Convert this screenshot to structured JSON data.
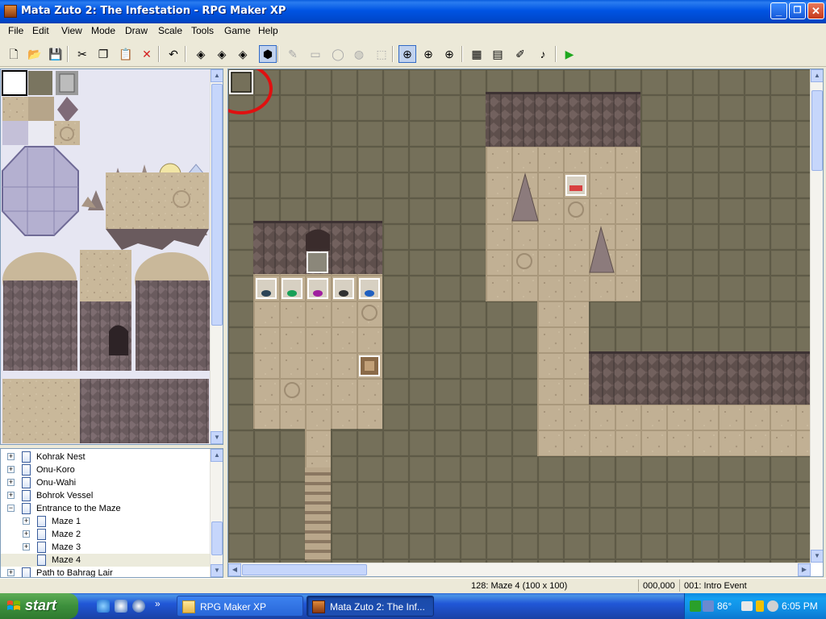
{
  "window": {
    "title": "Mata Zuto 2: The Infestation - RPG Maker XP",
    "minimize": "_",
    "maximize": "❐",
    "close": "✕"
  },
  "menu": [
    "File",
    "Edit",
    "View",
    "Mode",
    "Draw",
    "Scale",
    "Tools",
    "Game",
    "Help"
  ],
  "toolbar": {
    "buttons": [
      {
        "name": "new-project-button",
        "icon": "new-icon",
        "glyph": "🗋"
      },
      {
        "name": "open-project-button",
        "icon": "folder-open-icon",
        "glyph": "📂"
      },
      {
        "name": "save-project-button",
        "icon": "save-icon",
        "glyph": "💾"
      },
      {
        "name": "cut-button",
        "icon": "scissors-icon",
        "glyph": "✂"
      },
      {
        "name": "copy-button",
        "icon": "copy-icon",
        "glyph": "❐"
      },
      {
        "name": "paste-button",
        "icon": "paste-icon",
        "glyph": "📋"
      },
      {
        "name": "delete-button",
        "icon": "delete-icon",
        "glyph": "✕"
      },
      {
        "name": "undo-button",
        "icon": "undo-icon",
        "glyph": "↶"
      },
      {
        "name": "layer1-button",
        "icon": "layer1-icon",
        "glyph": "◈"
      },
      {
        "name": "layer2-button",
        "icon": "layer2-icon",
        "glyph": "◈"
      },
      {
        "name": "layer3-button",
        "icon": "layer3-icon",
        "glyph": "◈"
      },
      {
        "name": "event-layer-button",
        "icon": "event-layer-icon",
        "glyph": "⬢"
      },
      {
        "name": "pencil-button",
        "icon": "pencil-icon",
        "glyph": "✎"
      },
      {
        "name": "rectangle-button",
        "icon": "rectangle-icon",
        "glyph": "▭"
      },
      {
        "name": "ellipse-button",
        "icon": "ellipse-icon",
        "glyph": "◯"
      },
      {
        "name": "fill-button",
        "icon": "fill-icon",
        "glyph": "◍"
      },
      {
        "name": "select-button",
        "icon": "select-icon",
        "glyph": "⬚"
      },
      {
        "name": "zoom-1-1-button",
        "icon": "zoom-1-1-icon",
        "glyph": "⊕"
      },
      {
        "name": "zoom-1-2-button",
        "icon": "zoom-1-2-icon",
        "glyph": "⊕"
      },
      {
        "name": "zoom-1-4-button",
        "icon": "zoom-1-4-icon",
        "glyph": "⊕"
      },
      {
        "name": "database-button",
        "icon": "database-icon",
        "glyph": "▦"
      },
      {
        "name": "materialbase-button",
        "icon": "materialbase-icon",
        "glyph": "▤"
      },
      {
        "name": "script-editor-button",
        "icon": "script-icon",
        "glyph": "✐"
      },
      {
        "name": "sound-test-button",
        "icon": "music-note-icon",
        "glyph": "♪"
      },
      {
        "name": "playtest-button",
        "icon": "play-icon",
        "glyph": "▶"
      }
    ],
    "colors": {
      "playtest": "#1ea81e",
      "delete": "#d42020",
      "active_border": "#316ac5"
    }
  },
  "map_tree": [
    {
      "label": "Kohrak Nest",
      "expander": "+",
      "indent": 0
    },
    {
      "label": "Onu-Koro",
      "expander": "+",
      "indent": 0
    },
    {
      "label": "Onu-Wahi",
      "expander": "+",
      "indent": 0
    },
    {
      "label": "Bohrok Vessel",
      "expander": "+",
      "indent": 0
    },
    {
      "label": "Entrance to the Maze",
      "expander": "−",
      "indent": 0
    },
    {
      "label": "Maze 1",
      "expander": "+",
      "indent": 1
    },
    {
      "label": "Maze 2",
      "expander": "+",
      "indent": 1
    },
    {
      "label": "Maze 3",
      "expander": "+",
      "indent": 1
    },
    {
      "label": "Maze 4",
      "expander": "",
      "indent": 1,
      "selected": true
    },
    {
      "label": "Path to Bahrag Lair",
      "expander": "+",
      "indent": 0
    }
  ],
  "status": {
    "map_info": "128: Maze 4 (100 x 100)",
    "coords": "000,000",
    "event": "001: Intro Event"
  },
  "taskbar": {
    "start": "start",
    "tasks": [
      {
        "label": "RPG Maker XP",
        "icon": "folder-icon"
      },
      {
        "label": "Mata Zuto 2: The Inf...",
        "icon": "rpgmaker-icon"
      }
    ],
    "quicklaunch_chevron": "»",
    "tray_temp": "86°",
    "clock": "6:05 PM"
  },
  "map_colors": {
    "wall_floor": "#6f6a55",
    "sand_floor": "#bfae90",
    "rock_wall": "#5c4d48",
    "highlight_circle": "#e01010"
  }
}
